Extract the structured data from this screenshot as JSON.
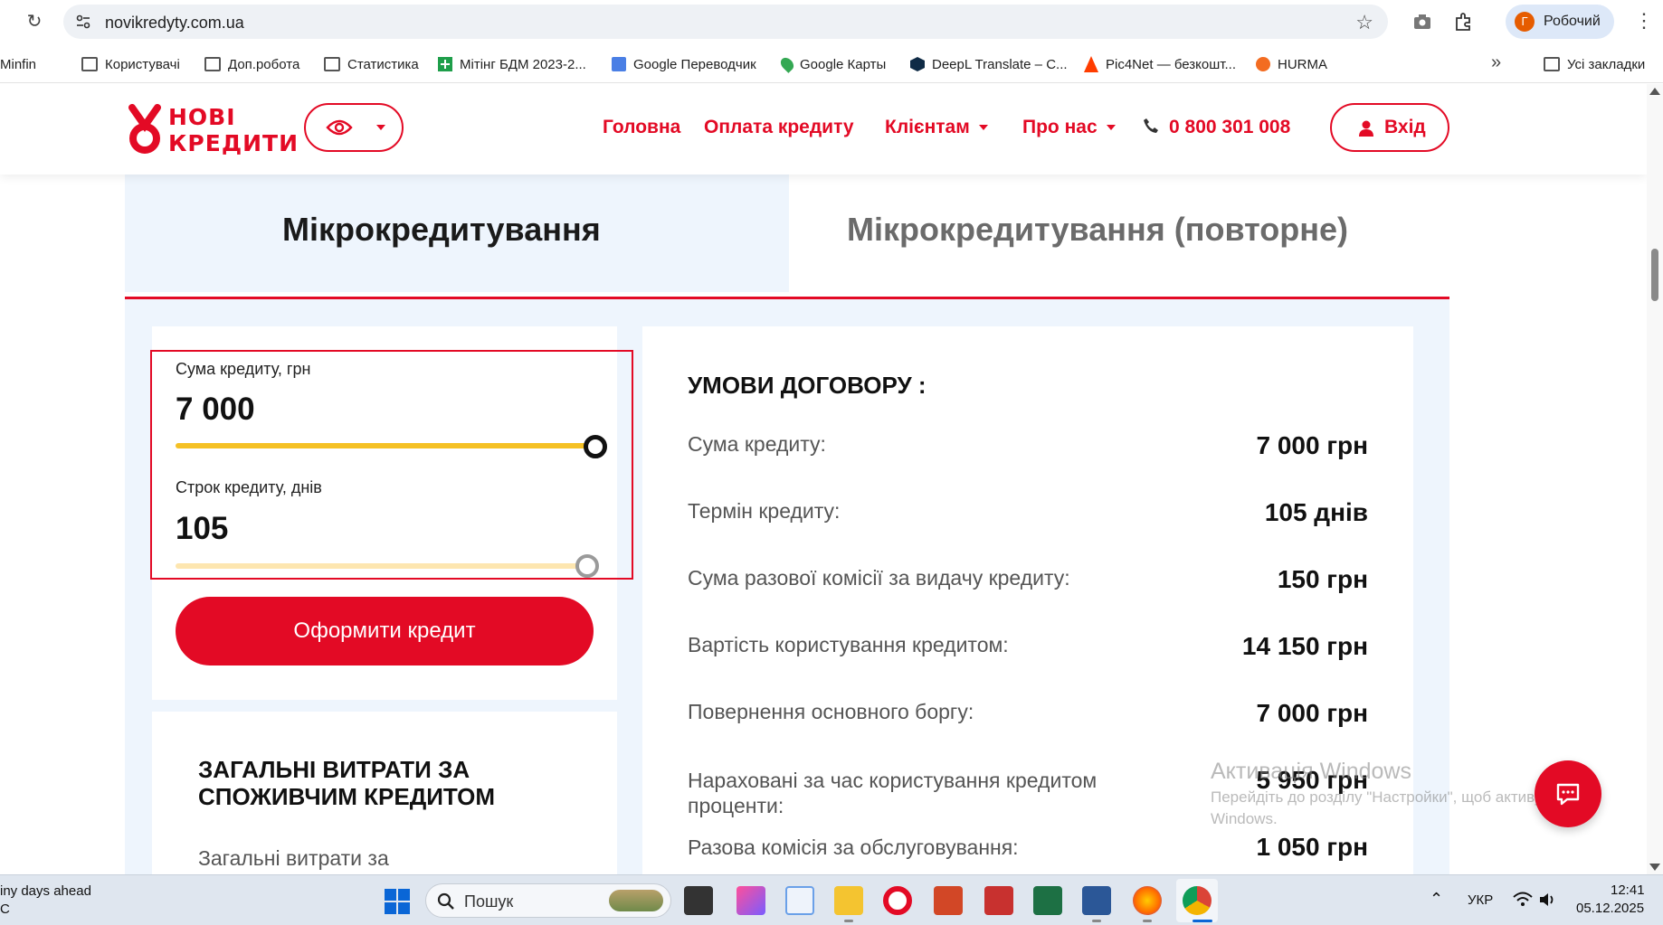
{
  "browser": {
    "url": "novikredyty.com.ua",
    "profile_initial": "Г",
    "profile_name": "Робочий"
  },
  "bookmarks": [
    {
      "label": "Minfin",
      "icon": "folder-icon"
    },
    {
      "label": "Користувачі",
      "icon": "folder-icon"
    },
    {
      "label": "Доп.робота",
      "icon": "folder-icon"
    },
    {
      "label": "Статистика",
      "icon": "folder-icon"
    },
    {
      "label": "Мітінг БДМ 2023-2...",
      "icon": "sheets-icon"
    },
    {
      "label": "Google Переводчик",
      "icon": "translate-icon"
    },
    {
      "label": "Google Карты",
      "icon": "maps-icon"
    },
    {
      "label": "DeepL Translate – C...",
      "icon": "deepl-icon"
    },
    {
      "label": "Pic4Net — безкошт...",
      "icon": "pic4net-icon"
    },
    {
      "label": "HURMA",
      "icon": "hurma-icon"
    }
  ],
  "all_bookmarks": "Усі закладки",
  "site": {
    "logo_line1": "НОВІ",
    "logo_line2": "КРЕДИТИ",
    "nav": [
      "Головна",
      "Оплата кредиту",
      "Клієнтам",
      "Про нас"
    ],
    "phone": "0 800 301 008",
    "login": "Вхід"
  },
  "tabs": {
    "active": "Мікрокредитування",
    "inactive": "Мікрокредитування (повторне)"
  },
  "calculator": {
    "amount_label": "Сума кредиту, грн",
    "amount_value": "7 000",
    "amount_fraction": 1.0,
    "term_label": "Строк кредиту, днів",
    "term_value": "105",
    "term_fraction": 1.0,
    "apply_button": "Оформити кредит"
  },
  "terms": {
    "title": "УМОВИ ДОГОВОРУ :",
    "rows": [
      {
        "label": "Сума кредиту:",
        "value": "7 000 грн"
      },
      {
        "label": "Термін кредиту:",
        "value": "105 днів"
      },
      {
        "label": "Сума разової комісії за видачу кредиту:",
        "value": "150 грн"
      },
      {
        "label": "Вартість користування кредитом:",
        "value": "14 150 грн"
      },
      {
        "label": "Повернення основного боргу:",
        "value": "7 000 грн"
      },
      {
        "label": "Нараховані за час користування кредитом проценти:",
        "value": "5 950 грн"
      },
      {
        "label": "Разова комісія за обслуговування:",
        "value": "1 050 грн"
      }
    ]
  },
  "expenses": {
    "title": "ЗАГАЛЬНІ ВИТРАТИ ЗА СПОЖИВЧИМ КРЕДИТОМ",
    "text": "Загальні витрати за"
  },
  "watermark": {
    "line1": "Активація Windows",
    "line2": "Перейдіть до розділу \"Настройки\", щоб активувати Windows."
  },
  "taskbar": {
    "weather_line1": "iny days ahead",
    "weather_line2": "C",
    "search_placeholder": "Пошук",
    "language": "УКР",
    "time": "12:41",
    "date": "05.12.2025"
  },
  "colors": {
    "brand_red": "#e30a25",
    "slider_yellow": "#f5c125",
    "slider_light": "#fde6b0",
    "tab_bg": "#eef5fd"
  }
}
